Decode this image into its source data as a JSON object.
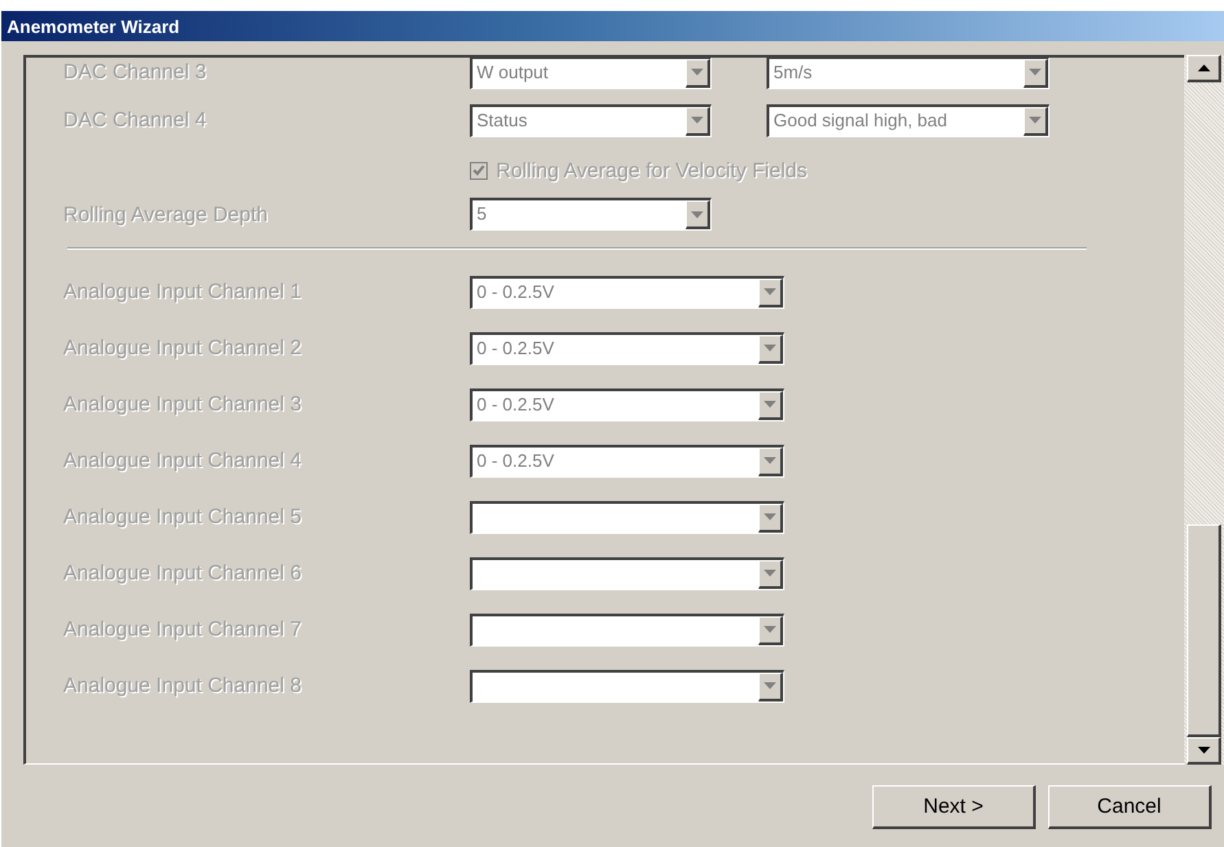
{
  "window": {
    "title": "Anemometer Wizard"
  },
  "fields": [
    {
      "kind": "dual",
      "label": "DAC Channel 3",
      "value": "W output",
      "value_2": "5m/s",
      "disabled": true
    },
    {
      "kind": "dual",
      "label": "DAC Channel 4",
      "value": "Status",
      "value_2": "Good signal high, bad",
      "disabled": true
    },
    {
      "kind": "check",
      "label": "Rolling Average for Velocity Fields",
      "checked": true,
      "disabled": true
    },
    {
      "kind": "single",
      "label": "Rolling Average Depth",
      "value": "5",
      "disabled": true
    },
    {
      "kind": "separator"
    },
    {
      "kind": "wide",
      "label": "Analogue Input Channel 1",
      "value": "0 - 0.2.5V",
      "disabled": true
    },
    {
      "kind": "wide",
      "label": "Analogue Input Channel 2",
      "value": "0 - 0.2.5V",
      "disabled": true
    },
    {
      "kind": "wide",
      "label": "Analogue Input Channel 3",
      "value": "0 - 0.2.5V",
      "disabled": true
    },
    {
      "kind": "wide",
      "label": "Analogue Input Channel 4",
      "value": "0 - 0.2.5V",
      "disabled": true
    },
    {
      "kind": "wide",
      "label": "Analogue Input Channel 5",
      "disabled": true
    },
    {
      "kind": "wide",
      "label": "Analogue Input Channel 6",
      "disabled": true
    },
    {
      "kind": "wide",
      "label": "Analogue Input Channel 7",
      "disabled": true
    },
    {
      "kind": "wide",
      "label": "Analogue Input Channel 8",
      "disabled": true
    }
  ],
  "buttons": [
    {
      "label": "Next >"
    },
    {
      "label": "Cancel"
    }
  ]
}
